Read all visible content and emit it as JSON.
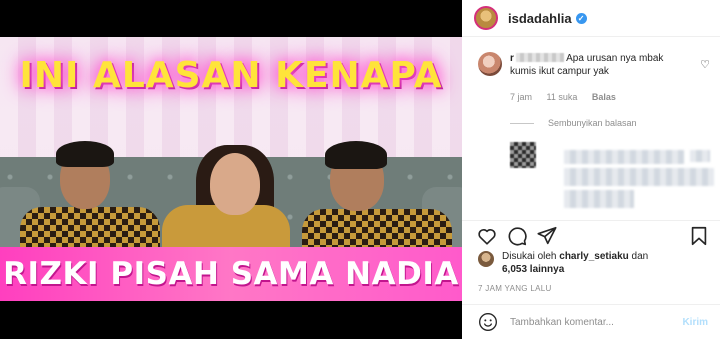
{
  "media": {
    "caption_top": "INI ALASAN KENAPA",
    "caption_bottom": "RIZKI PISAH SAMA NADIA"
  },
  "header": {
    "username": "isdadahlia",
    "verified_icon": "verified-badge-icon"
  },
  "comment": {
    "username_visible": "r",
    "text": "Apa urusan nya mbak kumis ikut campur yak",
    "time": "7 jam",
    "likes": "11 suka",
    "reply_label": "Balas",
    "hide_replies": "Sembunyikan balasan"
  },
  "actions": {
    "icons": [
      "heart-icon",
      "comment-icon",
      "share-icon",
      "bookmark-icon"
    ]
  },
  "likes": {
    "prefix": "Disukai oleh",
    "user": "charly_setiaku",
    "conjunction": "dan",
    "others": "6,053 lainnya"
  },
  "timestamp": "7 JAM YANG LALU",
  "add_comment": {
    "placeholder": "Tambahkan komentar...",
    "post_label": "Kirim"
  },
  "colors": {
    "verified": "#3897f0",
    "post_disabled": "#b2dffc",
    "caption_yellow": "#ffe43a",
    "caption_pink": "#ff3fbf"
  }
}
